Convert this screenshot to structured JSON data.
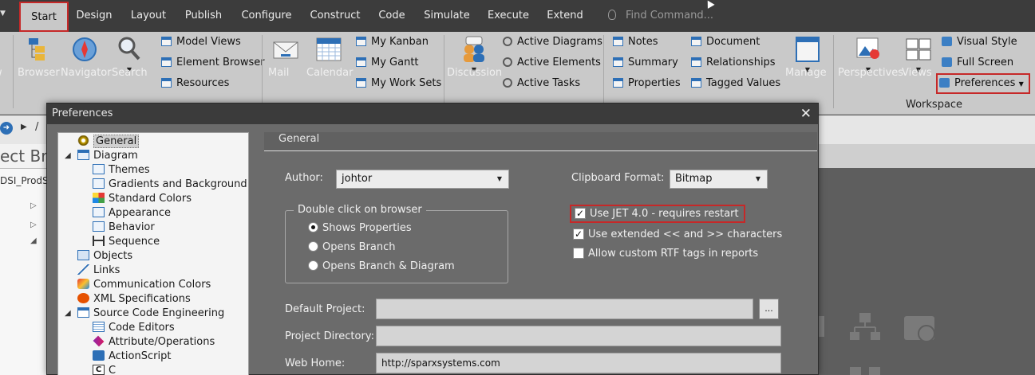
{
  "menubar": {
    "tabs": [
      "Start",
      "Design",
      "Layout",
      "Publish",
      "Configure",
      "Construct",
      "Code",
      "Simulate",
      "Execute",
      "Extend"
    ],
    "find_placeholder": "Find Command..."
  },
  "ribbon": {
    "partial_label": "w",
    "browser": "Browser",
    "navigator": "Navigator",
    "search": "Search",
    "model_views": "Model Views",
    "element_browser": "Element Browser",
    "resources": "Resources",
    "mail": "Mail",
    "calendar": "Calendar",
    "my_kanban": "My Kanban",
    "my_gantt": "My Gantt",
    "my_work_sets": "My Work Sets",
    "discussion": "Discussion",
    "active_diagrams": "Active Diagrams",
    "active_elements": "Active Elements",
    "active_tasks": "Active Tasks",
    "notes": "Notes",
    "summary": "Summary",
    "properties": "Properties",
    "document": "Document",
    "relationships": "Relationships",
    "tagged_values": "Tagged Values",
    "manage": "Manage",
    "perspectives": "Perspectives",
    "views": "Views",
    "visual_style": "Visual Style",
    "full_screen": "Full Screen",
    "preferences": "Preferences",
    "workspace_group": "Workspace"
  },
  "background": {
    "breadcrumb_sep": "/",
    "panel_title": "ect Bro",
    "project_label": "DSI_ProdS"
  },
  "dialog": {
    "title": "Preferences",
    "section_title": "General",
    "tree": [
      "General",
      "Diagram",
      "Themes",
      "Gradients and Background",
      "Standard Colors",
      "Appearance",
      "Behavior",
      "Sequence",
      "Objects",
      "Links",
      "Communication Colors",
      "XML Specifications",
      "Source Code Engineering",
      "Code Editors",
      "Attribute/Operations",
      "ActionScript",
      "C"
    ],
    "author_label": "Author:",
    "author_value": "johtor",
    "clipboard_label": "Clipboard Format:",
    "clipboard_value": "Bitmap",
    "dblclick_group": "Double click on browser",
    "radio_options": [
      "Shows Properties",
      "Opens Branch",
      "Opens Branch  & Diagram"
    ],
    "checks": [
      {
        "label": "Use JET 4.0 - requires restart",
        "checked": true
      },
      {
        "label": "Use extended << and >> characters",
        "checked": true
      },
      {
        "label": "Allow custom RTF tags in reports",
        "checked": false
      }
    ],
    "default_project_label": "Default Project:",
    "default_project_value": "",
    "browse_label": "...",
    "project_dir_label": "Project Directory:",
    "project_dir_value": "",
    "web_home_label": "Web Home:",
    "web_home_value": "http://sparxsystems.com"
  }
}
